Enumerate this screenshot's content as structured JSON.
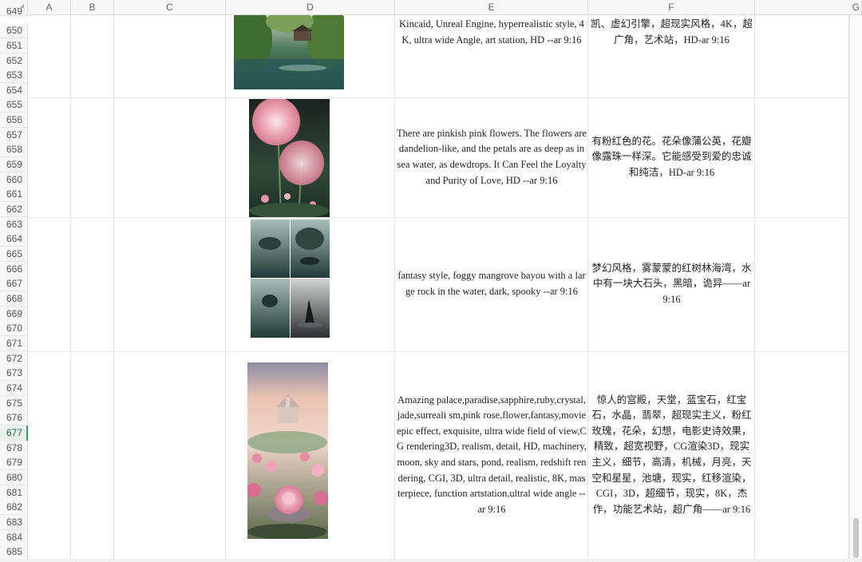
{
  "columns": [
    "A",
    "B",
    "C",
    "D",
    "E",
    "F",
    "G"
  ],
  "rows": [
    "649",
    "650",
    "651",
    "652",
    "653",
    "654",
    "655",
    "656",
    "657",
    "658",
    "659",
    "660",
    "661",
    "662",
    "663",
    "664",
    "665",
    "666",
    "667",
    "668",
    "669",
    "670",
    "671",
    "672",
    "673",
    "674",
    "675",
    "676",
    "677",
    "678",
    "679",
    "680",
    "681",
    "682",
    "683",
    "684",
    "685"
  ],
  "active_row": "677",
  "cells": {
    "e1": "Kincaid, Unreal Engine, hyperrealistic style, 4K, ultra wide Angle, art station, HD --ar 9:16",
    "f1": "凯、虚幻引擎，超现实风格，4K，超广角，艺术站，HD-ar 9:16",
    "e2": "There are pinkish pink flowers. The flowers are dandelion-like, and the petals are as deep as in sea water, as dewdrops. It Can Feel the Loyalty and Purity of Love, HD --ar 9:16",
    "f2": "有粉红色的花。花朵像蒲公英，花瓣像露珠一样深。它能感受到爱的忠诚和纯洁，HD-ar 9:16",
    "e3": "fantasy style, foggy mangrove bayou with a large rock in the water, dark, spooky --ar 9:16",
    "f3": "梦幻风格，雾蒙蒙的红树林海湾，水中有一块大石头，黑暗，诡异——ar 9:16",
    "e4": "Amazing palace,paradise,sapphire,ruby,crystal,jade,surreali sm,pink rose,flower,fantasy,movie epic effect, exquisite, ultra wide field of view,CG rendering3D, realism, detail, HD, machinery, moon, sky and stars, pond, realism, redshift rendering, CGI, 3D, ultra detail, realistic, 8K, masterpiece, function artstation,ultral wide angle --ar 9:16",
    "f4": "惊人的宫殿，天堂，蓝宝石，红宝石，水晶，翡翠，超现实主义，粉红玫瑰，花朵，幻想，电影史诗效果，精致，超宽视野，CG渲染3D，现实主义，细节，高清，机械，月亮，天空和星星，池塘，现实，红移渲染，CGI，3D，超细节，现实，8K，杰作，功能艺术站，超广角——ar 9:16"
  },
  "images": [
    "willow-lake-image",
    "pink-dandelion-flowers-image",
    "foggy-mangrove-bayou-image",
    "pink-palace-roses-image"
  ]
}
